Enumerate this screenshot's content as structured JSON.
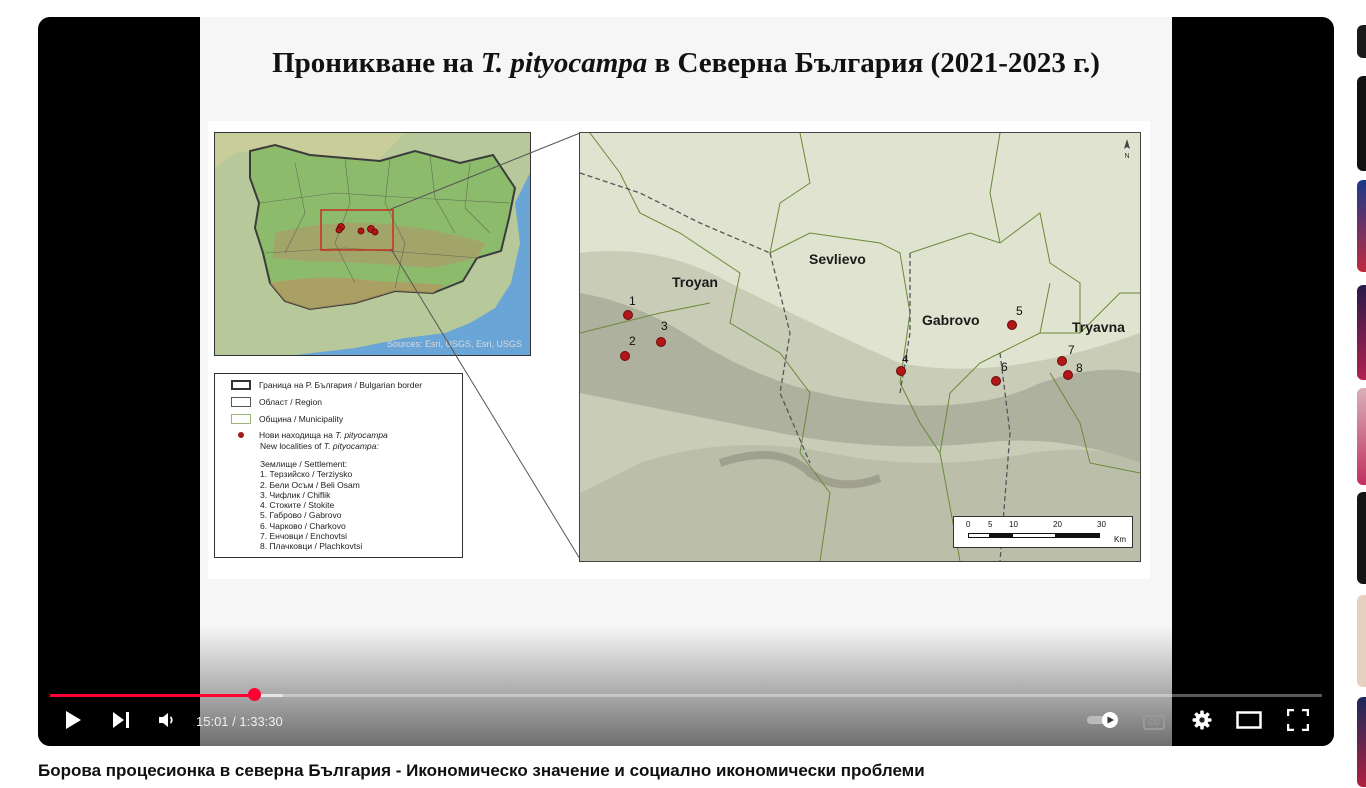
{
  "slide": {
    "title_before": "Проникване на ",
    "title_italic": "T. pityocampa",
    "title_after": " в Северна България (2021-2023 г.)"
  },
  "overview_map": {
    "credit": "Sources: Esri, USGS, Esri, USGS"
  },
  "legend": {
    "border": "Граница на Р. България / Bulgarian border",
    "region": "Област / Region",
    "municipality": "Община / Municipality",
    "new_localities_bg_prefix": "Нови находища на ",
    "new_localities_species": "T. pityocampa",
    "new_localities_en_prefix": "New localities of ",
    "new_localities_en_species": "T. pityocampa:",
    "settlement_header": "Землище / Settlement:",
    "settlements": [
      "1. Терзийско / Terziysko",
      "2. Бели Осъм / Beli Osam",
      "3. Чифлик / Chiflik",
      "4. Стоките / Stokite",
      "5. Габрово / Gabrovo",
      "6. Чарково / Charkovo",
      "7. Енчовци / Enchovtsi",
      "8. Плачковци / Plachkovtsi"
    ]
  },
  "detail_map": {
    "places": [
      "Troyan",
      "Sevlievo",
      "Gabrovo",
      "Tryavna"
    ],
    "localities": [
      "1",
      "2",
      "3",
      "4",
      "5",
      "6",
      "7",
      "8"
    ],
    "north_label": "N",
    "scale": {
      "ticks": [
        "0",
        "5",
        "10",
        "20",
        "30"
      ],
      "unit": "Km"
    }
  },
  "player": {
    "current_time": "15:01",
    "duration": "1:33:30",
    "time_display": "15:01 / 1:33:30",
    "progress_fraction": 0.1607,
    "buffered_fraction": 0.183,
    "accent_color": "#ff0033",
    "icons": [
      "play-icon",
      "next-icon",
      "volume-icon",
      "autoplay-toggle-icon",
      "captions-icon",
      "settings-gear-icon",
      "theater-mode-icon",
      "fullscreen-icon"
    ],
    "captions_label": "CC"
  },
  "video": {
    "title": "Борова процесионка в северна България - Икономическо значение и социално икономически проблеми"
  }
}
